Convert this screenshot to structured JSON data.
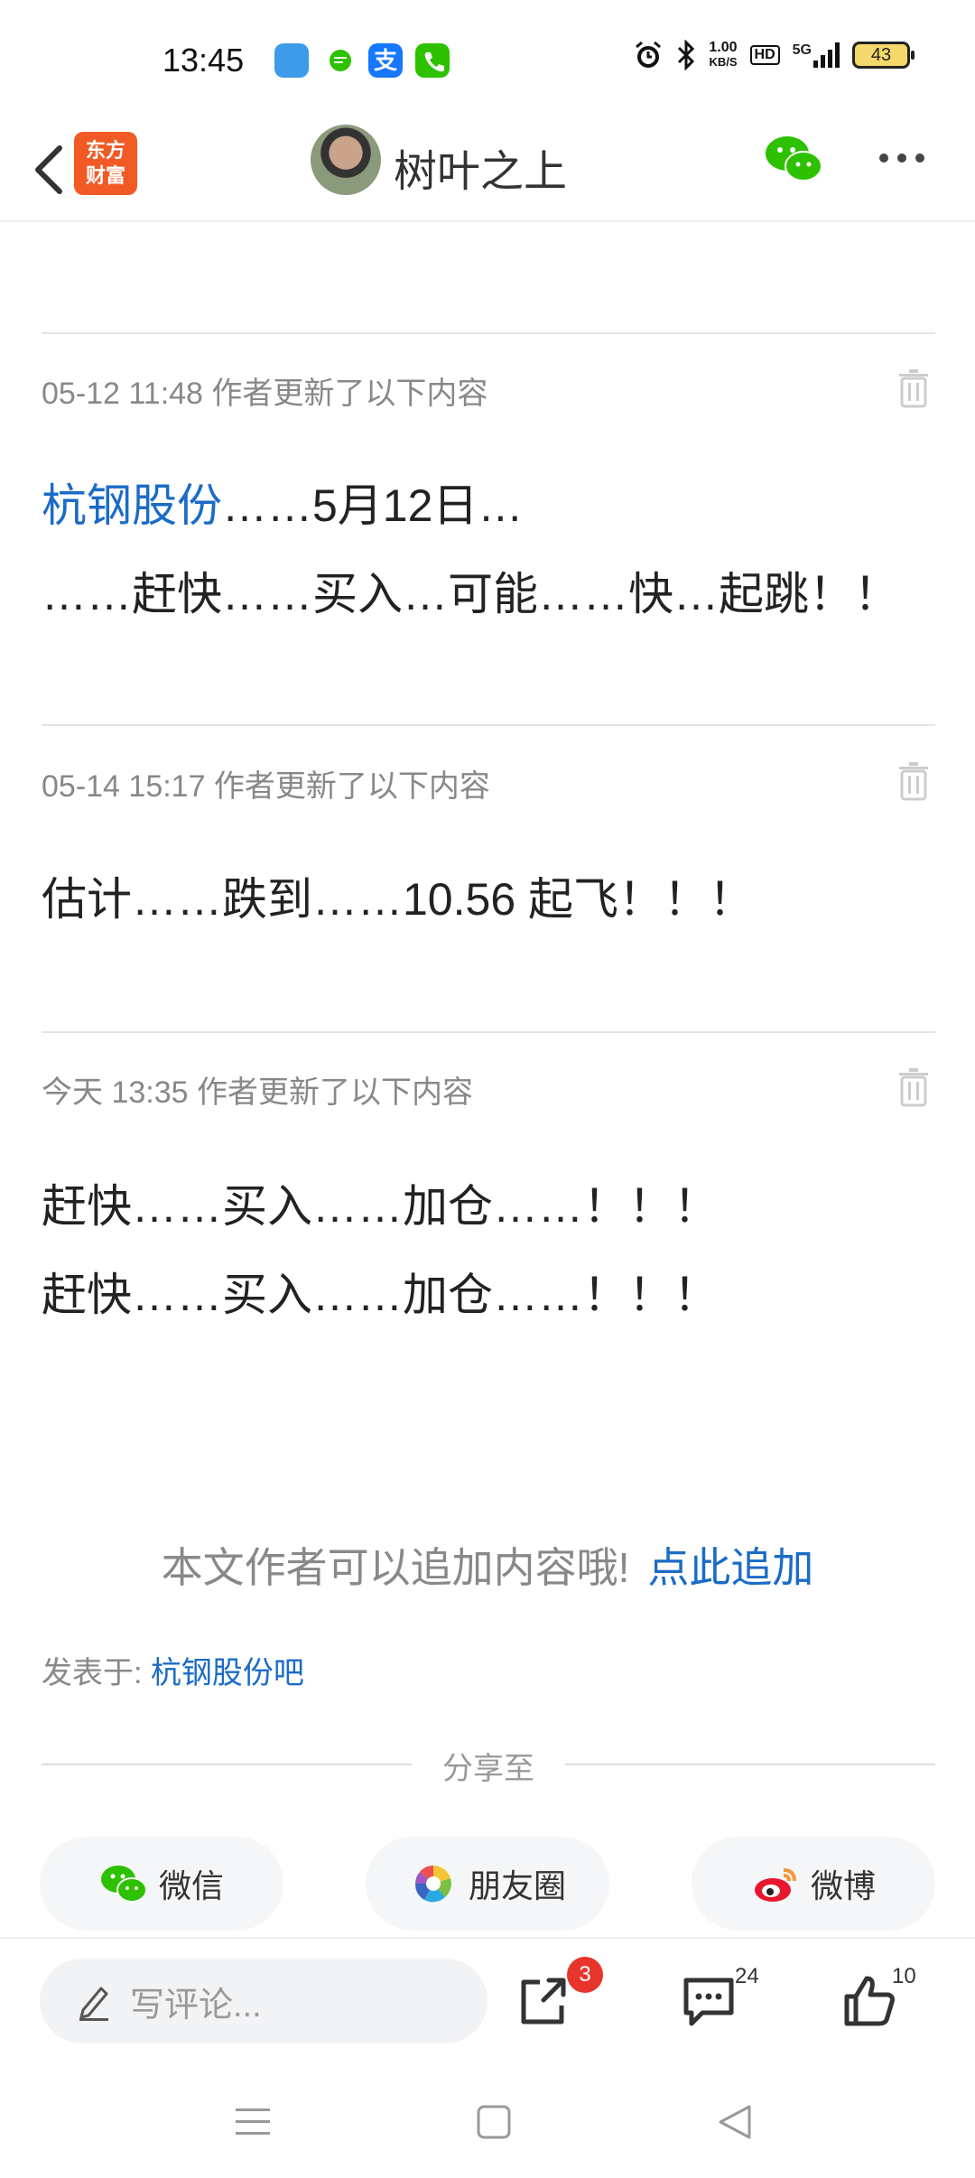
{
  "status_bar": {
    "time": "13:45",
    "net_speed_value": "1.00",
    "net_speed_unit": "KB/S",
    "hd": "HD",
    "network": "5G",
    "battery": "43"
  },
  "header": {
    "brand_line1": "东方",
    "brand_line2": "财富",
    "author_name": "树叶之上",
    "icons": [
      "back-arrow-icon",
      "avatar",
      "wechat-icon",
      "more-icon"
    ]
  },
  "updates": [
    {
      "meta": "05-12 11:48  作者更新了以下内容",
      "line1_link": "杭钢股份",
      "line1_text": "……5月12日…",
      "line2": "……赶快……买入…可能……快…起跳！！"
    },
    {
      "meta": "05-14 15:17  作者更新了以下内容",
      "line1": "估计……跌到……10.56 起飞！！！"
    },
    {
      "meta": "今天 13:35  作者更新了以下内容",
      "line1": "赶快……买入……加仓……！！！",
      "line2": "赶快……买入……加仓……！！！"
    }
  ],
  "append_hint": {
    "text": "本文作者可以追加内容哦!",
    "link": "点此追加"
  },
  "posted_in": {
    "label": "发表于: ",
    "link": "杭钢股份吧"
  },
  "share": {
    "title": "分享至",
    "wechat": "微信",
    "moments": "朋友圈",
    "weibo": "微博"
  },
  "bottom_bar": {
    "comment_placeholder": "写评论...",
    "share_badge": "3",
    "comment_count": "24",
    "like_count": "10"
  },
  "colors": {
    "link": "#1b6bc7",
    "brand": "#f15a24",
    "wechat": "#2dc100",
    "badge": "#e8352c"
  }
}
